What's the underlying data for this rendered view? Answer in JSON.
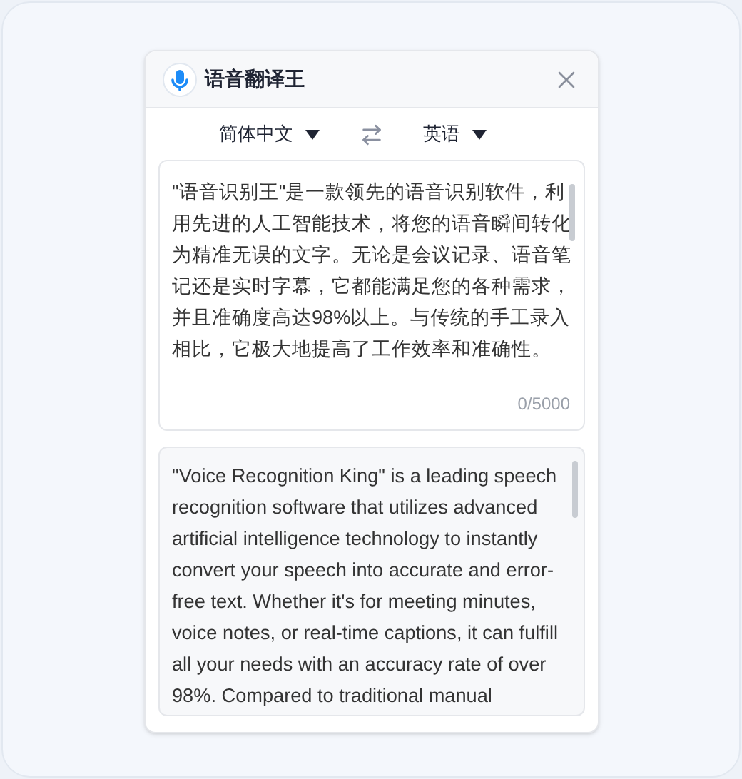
{
  "window": {
    "title": "语音翻译王"
  },
  "languages": {
    "source": "简体中文",
    "target": "英语"
  },
  "input": {
    "placeholder": "\"语音识别王\"是一款领先的语音识别软件，利用先进的人工智能技术，将您的语音瞬间转化为精准无误的文字。无论是会议记录、语音笔记还是实时字幕，它都能满足您的各种需求，并且准确度高达98%以上。与传统的手工录入相比，它极大地提高了工作效率和准确性。",
    "counter": "0/5000"
  },
  "output": {
    "text": "\"Voice Recognition King\" is a leading speech recognition software that utilizes advanced artificial intelligence technology to instantly convert your speech into accurate and error-free text. Whether it's for meeting minutes, voice notes, or real-time captions, it can fulfill all your needs with an accuracy rate of over 98%. Compared to traditional manual"
  }
}
